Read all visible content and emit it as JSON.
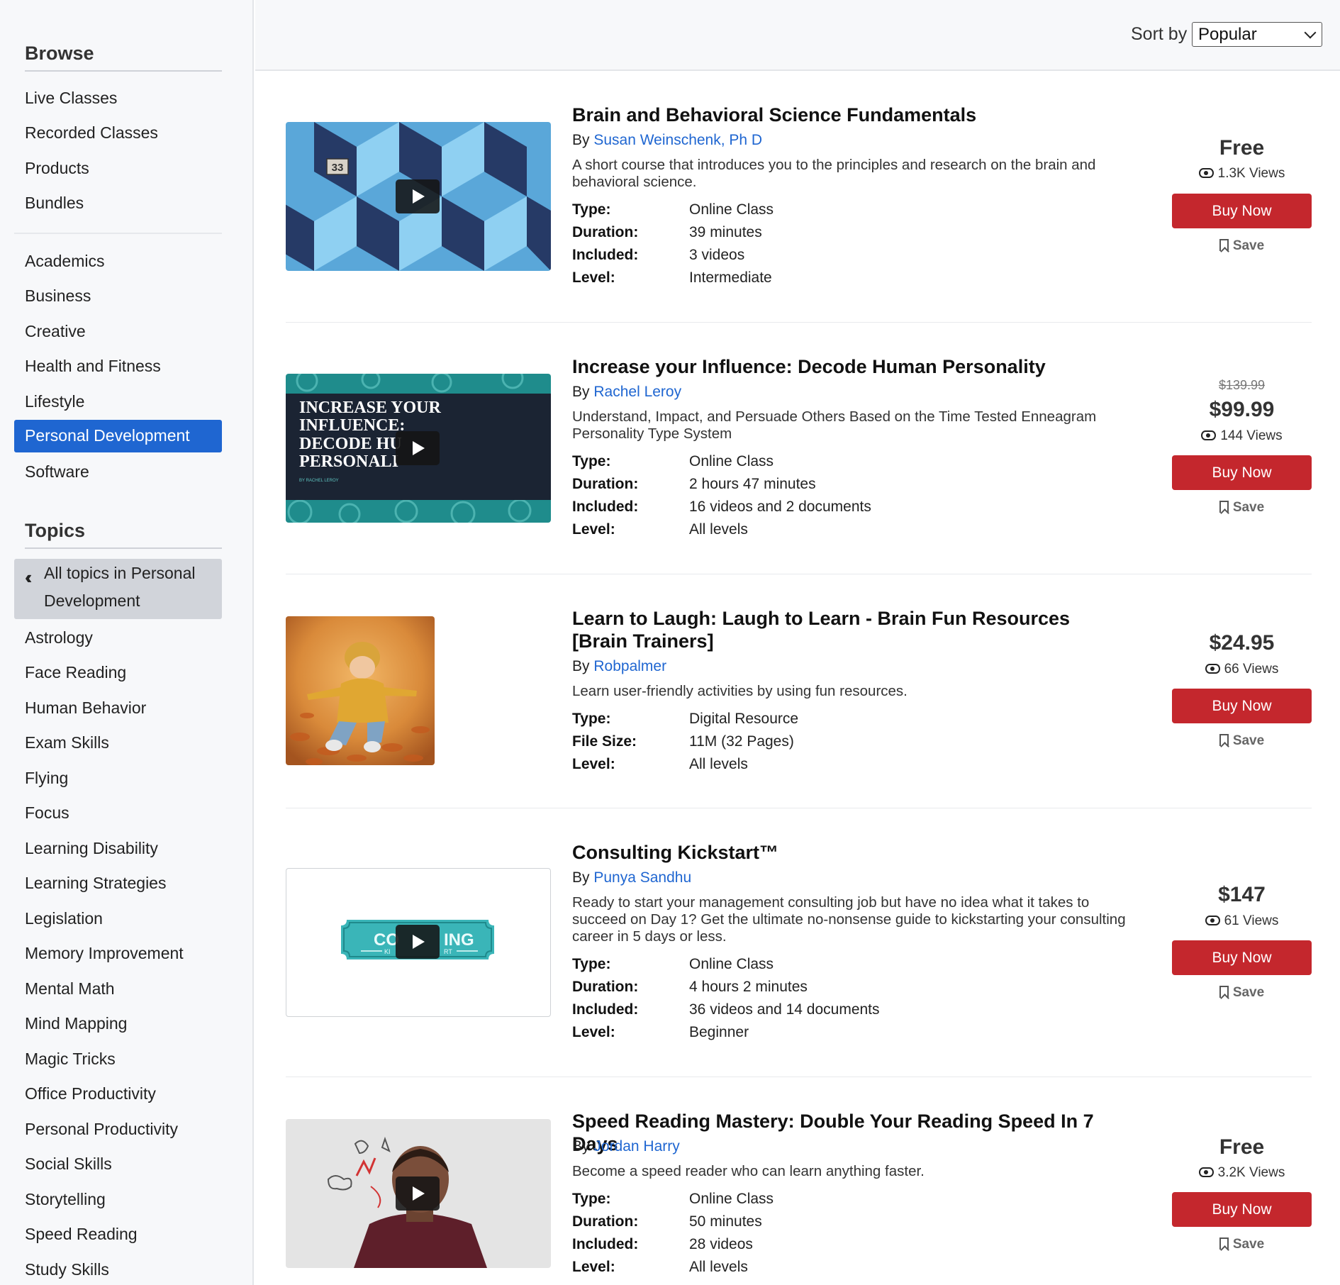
{
  "sidebar": {
    "browse_heading": "Browse",
    "browse_items": [
      "Live Classes",
      "Recorded Classes",
      "Products",
      "Bundles"
    ],
    "category_items": [
      "Academics",
      "Business",
      "Creative",
      "Health and Fitness",
      "Lifestyle",
      "Personal Development",
      "Software"
    ],
    "active_category": "Personal Development",
    "topics_heading": "Topics",
    "all_topics_label": "All topics in Personal Development",
    "topic_items": [
      "Astrology",
      "Face Reading",
      "Human Behavior",
      "Exam Skills",
      "Flying",
      "Focus",
      "Learning Disability",
      "Learning Strategies",
      "Legislation",
      "Memory Improvement",
      "Mental Math",
      "Mind Mapping",
      "Magic Tricks",
      "Office Productivity",
      "Personal Productivity",
      "Social Skills",
      "Storytelling",
      "Speed Reading",
      "Study Skills"
    ]
  },
  "header": {
    "sort_label": "Sort by",
    "sort_value": "Popular"
  },
  "labels": {
    "by": "By",
    "buy": "Buy Now",
    "save": "Save"
  },
  "items": [
    {
      "title": "Brain and Behavioral Science Fundamentals",
      "author": "Susan Weinschenk, Ph D",
      "description": "A short course that introduces you to the principles and research on the brain and behavioral science.",
      "meta": [
        [
          "Type:",
          "Online Class"
        ],
        [
          "Duration:",
          "39 minutes"
        ],
        [
          "Included:",
          "3 videos"
        ],
        [
          "Level:",
          "Intermediate"
        ]
      ],
      "price": "Free",
      "views": "1.3K Views"
    },
    {
      "title": "Increase your Influence: Decode Human Personality",
      "author": "Rachel Leroy",
      "description": "Understand, Impact, and Persuade Others Based on the Time Tested Enneagram Personality Type System",
      "meta": [
        [
          "Type:",
          "Online Class"
        ],
        [
          "Duration:",
          "2 hours 47 minutes"
        ],
        [
          "Included:",
          "16 videos and 2 documents"
        ],
        [
          "Level:",
          "All levels"
        ]
      ],
      "old_price": "$139.99",
      "price": "$99.99",
      "views": "144 Views",
      "thumb_text": "INCREASE YOUR INFLUENCE: DECODE HU PERSONALI",
      "thumb_sub": "BY RACHEL LEROY"
    },
    {
      "title": "Learn to Laugh: Laugh to Learn - Brain Fun Resources [Brain Trainers]",
      "author": "Robpalmer",
      "description": "Learn user-friendly activities by using fun resources.",
      "meta": [
        [
          "Type:",
          "Digital Resource"
        ],
        [
          "File Size:",
          "11M (32 Pages)"
        ],
        [
          "Level:",
          "All levels"
        ]
      ],
      "price": "$24.95",
      "views": "66 Views"
    },
    {
      "title": "Consulting Kickstart™",
      "author": "Punya Sandhu",
      "description": "Ready to start your management consulting job but have no idea what it takes to succeed on Day 1? Get the ultimate no-nonsense guide to kickstarting your consulting career in 5 days or less.",
      "meta": [
        [
          "Type:",
          "Online Class"
        ],
        [
          "Duration:",
          "4 hours 2 minutes"
        ],
        [
          "Included:",
          "36 videos and 14 documents"
        ],
        [
          "Level:",
          "Beginner"
        ]
      ],
      "price": "$147",
      "views": "61 Views",
      "thumb_text_left": "CO",
      "thumb_text_right": "ING",
      "thumb_sub_left": "KI",
      "thumb_sub_right": "RT"
    },
    {
      "title": "Speed Reading Mastery: Double Your Reading Speed In 7 Days",
      "author": "Jordan Harry",
      "description": "Become a speed reader who can learn anything faster.",
      "meta": [
        [
          "Type:",
          "Online Class"
        ],
        [
          "Duration:",
          "50 minutes"
        ],
        [
          "Included:",
          "28 videos"
        ],
        [
          "Level:",
          "All levels"
        ]
      ],
      "price": "Free",
      "views": "3.2K Views"
    }
  ]
}
